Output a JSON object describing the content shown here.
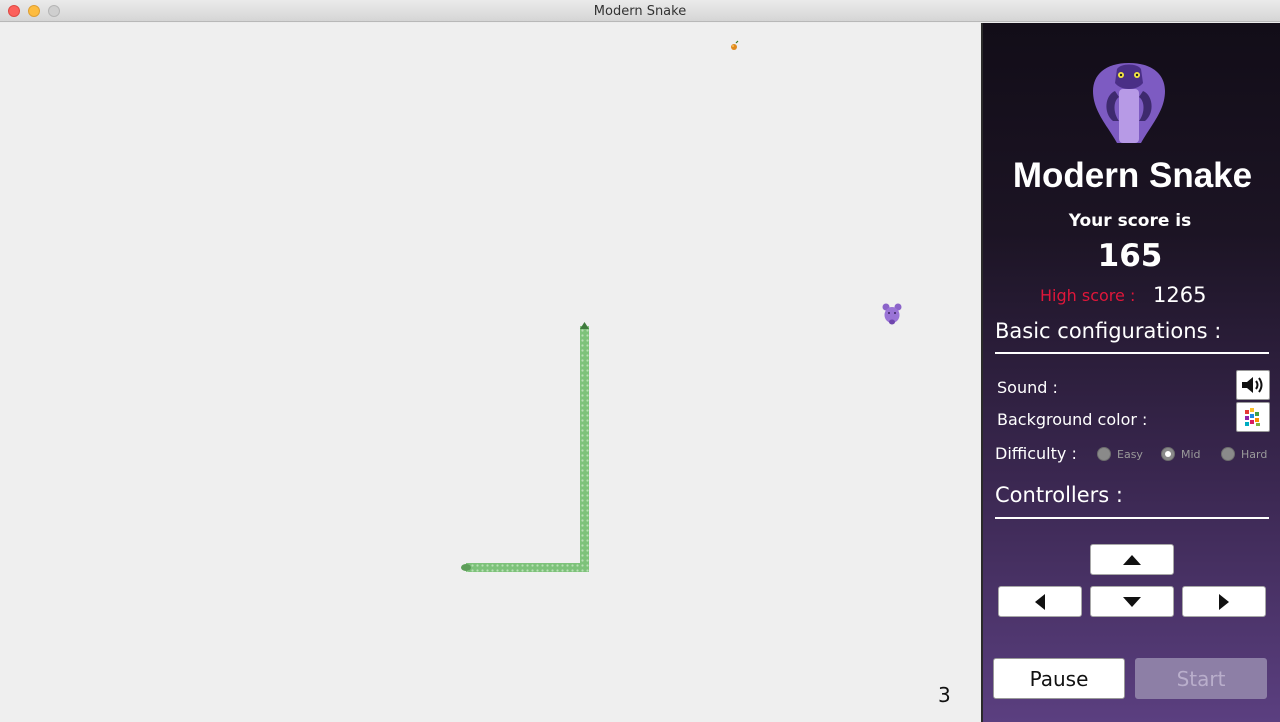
{
  "window": {
    "title": "Modern Snake"
  },
  "board": {
    "background_color": "#efefef",
    "snake_color": "#7dc27a",
    "snake_head_color": "#3f7a3d",
    "food_icon": "fruit-icon",
    "bonus_icon": "purple-mouse-icon",
    "level_number": "3"
  },
  "panel": {
    "logo_icon": "cobra-icon",
    "app_name": "Modern Snake",
    "score_caption": "Your score is",
    "score_value": "165",
    "high_score_label": "High score :",
    "high_score_value": "1265",
    "basic_config_title": "Basic configurations :",
    "sound_label": "Sound :",
    "sound_icon": "speaker-icon",
    "background_color_label": "Background color :",
    "background_color_icon": "color-palette-icon",
    "difficulty_label": "Difficulty :",
    "difficulty_options": [
      {
        "label": "Easy",
        "selected": false
      },
      {
        "label": "Mid",
        "selected": true
      },
      {
        "label": "Hard",
        "selected": false
      }
    ],
    "controllers_title": "Controllers :",
    "pause_label": "Pause",
    "start_label": "Start",
    "accent_color": "#e0163a"
  }
}
